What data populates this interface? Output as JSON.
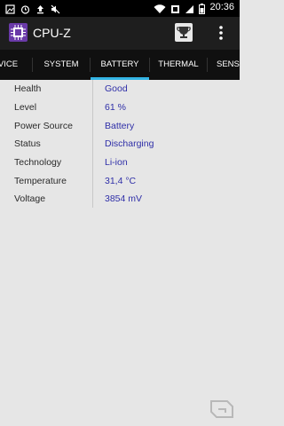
{
  "status_bar": {
    "time": "20:36",
    "icons": [
      "gallery-icon",
      "alarm-icon",
      "upload-icon",
      "mute-icon",
      "wifi-icon",
      "screenshot-icon",
      "signal-icon",
      "battery-icon"
    ]
  },
  "app": {
    "title": "CPU-Z",
    "icons": {
      "logo": "cpu-chip-icon",
      "trophy": "trophy-icon",
      "menu": "overflow-menu-icon"
    }
  },
  "tabs": [
    {
      "label": "VICE",
      "active": false
    },
    {
      "label": "SYSTEM",
      "active": false
    },
    {
      "label": "BATTERY",
      "active": true
    },
    {
      "label": "THERMAL",
      "active": false
    },
    {
      "label": "SENS",
      "active": false
    }
  ],
  "battery": {
    "rows": [
      {
        "label": "Health",
        "value": "Good"
      },
      {
        "label": "Level",
        "value": "61 %"
      },
      {
        "label": "Power Source",
        "value": "Battery"
      },
      {
        "label": "Status",
        "value": "Discharging"
      },
      {
        "label": "Technology",
        "value": "Li-ion"
      },
      {
        "label": "Temperature",
        "value": "31,4 °C"
      },
      {
        "label": "Voltage",
        "value": "3854 mV"
      }
    ]
  },
  "colors": {
    "accent": "#33b5e5",
    "value_text": "#2f2fa8",
    "background": "#e6e6e6",
    "app_bar": "#1e1e1e"
  }
}
